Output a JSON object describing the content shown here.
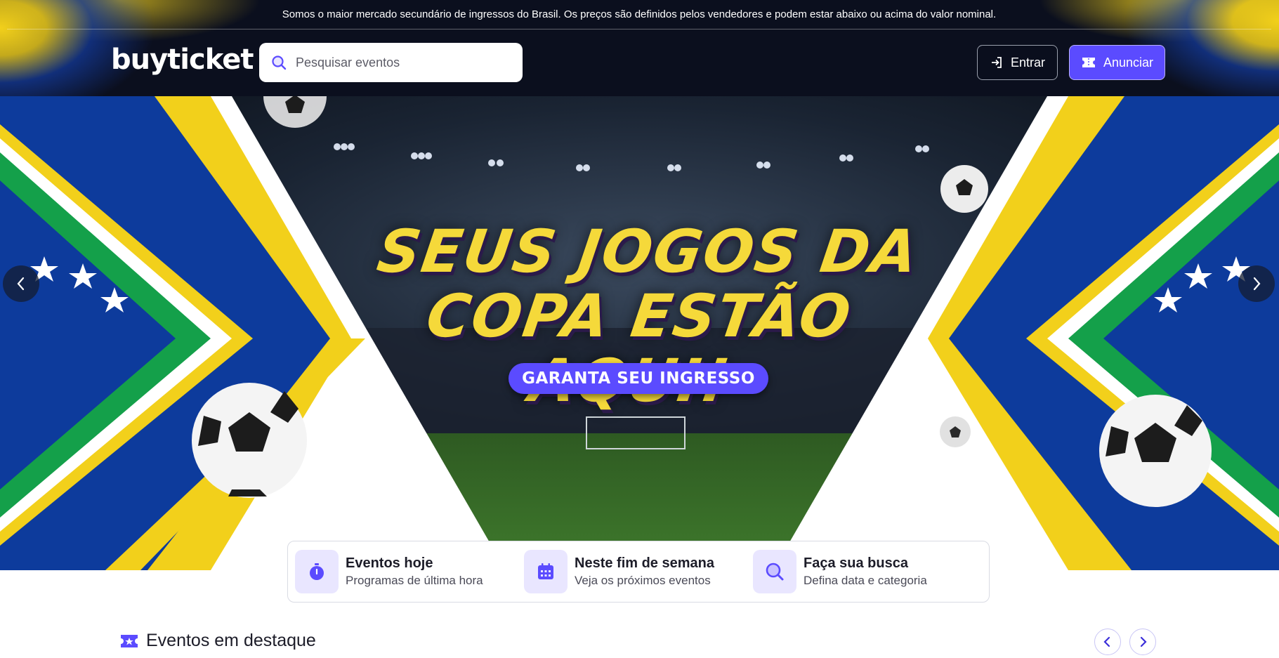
{
  "topbar": {
    "notice": "Somos o maior mercado secundário de ingressos do Brasil. Os preços são definidos pelos vendedores e podem estar abaixo ou acima do valor nominal."
  },
  "header": {
    "logo": "buyticket",
    "search": {
      "placeholder": "Pesquisar eventos",
      "value": ""
    },
    "login_label": "Entrar",
    "advertise_label": "Anunciar"
  },
  "hero": {
    "title_line1": "SEUS JOGOS DA",
    "title_line2": "COPA ESTÃO AQUI!",
    "cta_label": "GARANTA SEU INGRESSO"
  },
  "quick_links": [
    {
      "icon": "stopwatch-icon",
      "title": "Eventos hoje",
      "subtitle": "Programas de última hora"
    },
    {
      "icon": "calendar-icon",
      "title": "Neste fim de semana",
      "subtitle": "Veja os próximos eventos"
    },
    {
      "icon": "search-icon",
      "title": "Faça sua busca",
      "subtitle": "Defina data e categoria"
    }
  ],
  "featured": {
    "title": "Eventos em destaque"
  },
  "colors": {
    "brand": "#5b4bff",
    "brand_light": "#e9e6ff",
    "flag_yellow": "#f2d01b",
    "flag_green": "#14a04a",
    "flag_blue": "#0d3b9c"
  }
}
